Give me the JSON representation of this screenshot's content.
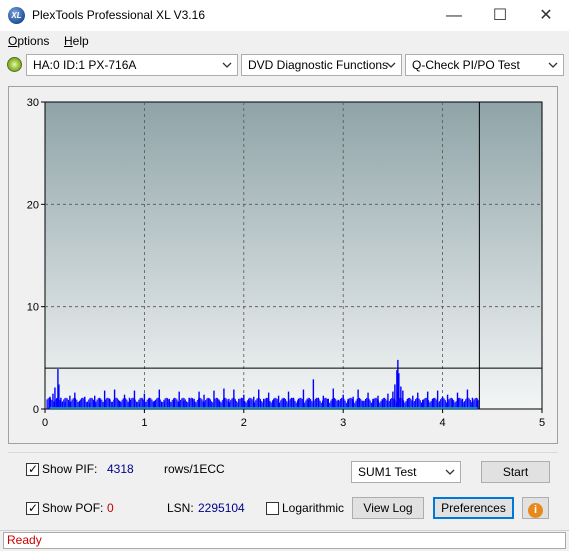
{
  "window": {
    "title": "PlexTools Professional XL V3.16",
    "icon_label": "XL",
    "minimize": "—",
    "maximize": "☐",
    "close": "✕"
  },
  "menu": {
    "options": "Options",
    "options_accel": "O",
    "options_rest": "ptions",
    "help": "Help",
    "help_accel": "H",
    "help_rest": "elp"
  },
  "toolbar": {
    "drive": "HA:0 ID:1  PX-716A",
    "function": "DVD Diagnostic Functions",
    "test": "Q-Check PI/PO Test"
  },
  "chart_data": {
    "type": "bar",
    "x_ticks": [
      "0",
      "1",
      "2",
      "3",
      "4",
      "5"
    ],
    "y_ticks": [
      "0",
      "10",
      "20",
      "30"
    ],
    "xlim": [
      0,
      5
    ],
    "ylim": [
      0,
      30
    ],
    "grid": true,
    "threshold_y": 4,
    "end_marker_x": 4.37,
    "colors": {
      "pif": "#0000ff",
      "pof": "#00b0b0",
      "background_top": "#8fa4a8",
      "background_bottom": "#f4f6f6"
    },
    "series": [
      {
        "values": [
          [
            0.05,
            1.2
          ],
          [
            0.08,
            1.5
          ],
          [
            0.1,
            2.1
          ],
          [
            0.12,
            1.0
          ],
          [
            0.13,
            3.9
          ],
          [
            0.14,
            2.4
          ],
          [
            0.16,
            1.1
          ],
          [
            0.2,
            0.7
          ],
          [
            0.25,
            1.3
          ],
          [
            0.3,
            1.6
          ],
          [
            0.35,
            0.8
          ],
          [
            0.4,
            1.2
          ],
          [
            0.45,
            0.6
          ],
          [
            0.5,
            1.3
          ],
          [
            0.55,
            0.9
          ],
          [
            0.6,
            1.8
          ],
          [
            0.65,
            1.0
          ],
          [
            0.7,
            1.9
          ],
          [
            0.75,
            0.8
          ],
          [
            0.8,
            1.4
          ],
          [
            0.85,
            1.1
          ],
          [
            0.9,
            1.8
          ],
          [
            0.95,
            0.6
          ],
          [
            1.0,
            1.5
          ],
          [
            1.05,
            1.0
          ],
          [
            1.1,
            0.8
          ],
          [
            1.15,
            1.9
          ],
          [
            1.2,
            0.7
          ],
          [
            1.25,
            1.0
          ],
          [
            1.3,
            0.9
          ],
          [
            1.35,
            1.7
          ],
          [
            1.4,
            0.8
          ],
          [
            1.45,
            1.1
          ],
          [
            1.5,
            1.0
          ],
          [
            1.55,
            1.7
          ],
          [
            1.6,
            1.4
          ],
          [
            1.65,
            1.0
          ],
          [
            1.7,
            1.8
          ],
          [
            1.75,
            0.9
          ],
          [
            1.8,
            2.0
          ],
          [
            1.85,
            1.0
          ],
          [
            1.9,
            1.9
          ],
          [
            1.95,
            1.0
          ],
          [
            2.0,
            1.4
          ],
          [
            2.05,
            0.8
          ],
          [
            2.1,
            1.2
          ],
          [
            2.15,
            1.9
          ],
          [
            2.2,
            1.0
          ],
          [
            2.25,
            1.6
          ],
          [
            2.3,
            0.9
          ],
          [
            2.35,
            1.3
          ],
          [
            2.4,
            1.0
          ],
          [
            2.45,
            1.7
          ],
          [
            2.5,
            1.1
          ],
          [
            2.55,
            1.0
          ],
          [
            2.6,
            1.9
          ],
          [
            2.65,
            0.9
          ],
          [
            2.7,
            2.9
          ],
          [
            2.75,
            1.1
          ],
          [
            2.8,
            1.3
          ],
          [
            2.85,
            1.0
          ],
          [
            2.9,
            2.0
          ],
          [
            2.95,
            0.9
          ],
          [
            3.0,
            1.4
          ],
          [
            3.05,
            1.0
          ],
          [
            3.1,
            1.2
          ],
          [
            3.15,
            1.9
          ],
          [
            3.2,
            0.8
          ],
          [
            3.25,
            1.6
          ],
          [
            3.3,
            1.0
          ],
          [
            3.35,
            1.3
          ],
          [
            3.4,
            0.9
          ],
          [
            3.45,
            1.5
          ],
          [
            3.5,
            1.7
          ],
          [
            3.52,
            2.4
          ],
          [
            3.54,
            3.8
          ],
          [
            3.55,
            4.8
          ],
          [
            3.56,
            3.5
          ],
          [
            3.58,
            2.2
          ],
          [
            3.6,
            1.8
          ],
          [
            3.65,
            1.0
          ],
          [
            3.7,
            1.3
          ],
          [
            3.75,
            1.6
          ],
          [
            3.8,
            0.9
          ],
          [
            3.85,
            1.7
          ],
          [
            3.9,
            1.0
          ],
          [
            3.95,
            1.8
          ],
          [
            4.0,
            1.2
          ],
          [
            4.05,
            1.4
          ],
          [
            4.1,
            0.9
          ],
          [
            4.15,
            1.6
          ],
          [
            4.2,
            1.0
          ],
          [
            4.25,
            1.9
          ],
          [
            4.3,
            1.1
          ],
          [
            4.35,
            0.8
          ]
        ]
      },
      {
        "values": [
          [
            0.05,
            0.0
          ],
          [
            0.2,
            0.0
          ],
          [
            0.5,
            0.0
          ],
          [
            1.0,
            0.0
          ],
          [
            2.0,
            0.0
          ],
          [
            3.0,
            0.0
          ],
          [
            4.0,
            0.0
          ],
          [
            4.35,
            0.0
          ]
        ]
      }
    ]
  },
  "controls": {
    "show_pif_label": "Show PIF:",
    "show_pif_value": "4318",
    "rows_unit": "rows/1ECC",
    "show_pof_label": "Show POF:",
    "show_pof_value": "0",
    "lsn_label": "LSN:",
    "lsn_value": "2295104",
    "logarithmic_label": "Logarithmic",
    "test_select": "SUM1 Test",
    "start_label": "Start",
    "view_log_label": "View Log",
    "preferences_label": "Preferences",
    "info_icon": "i"
  },
  "status": {
    "text": "Ready"
  }
}
